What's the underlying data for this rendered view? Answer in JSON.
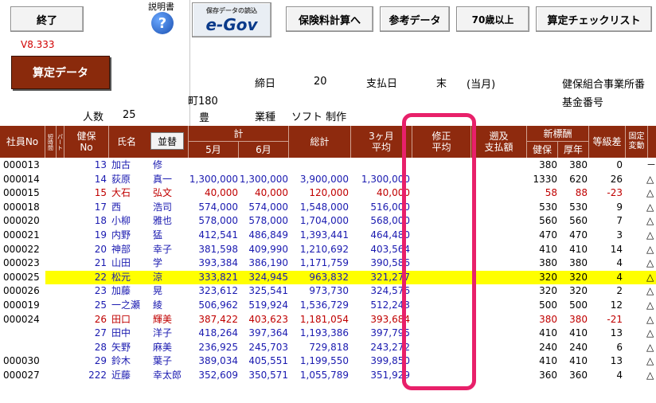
{
  "toolbar": {
    "end_label": "終了",
    "help_label": "説明書",
    "egov_sub": "保存データの読込",
    "egov_label": "e-Gov",
    "calc_label": "保険料計算へ",
    "ref_label": "参考データ",
    "over70_label": "70歳以上",
    "check_label": "算定チェックリスト"
  },
  "version": "V8.333",
  "santei_label": "算定データ",
  "info": {
    "shimebi_label": "締日",
    "shimebi_value": "20",
    "shiharai_label": "支払日",
    "shiharai_value": "末",
    "shiharai_note": "(当月)",
    "kenpo_label": "健保組合事業所番",
    "kikin_label": "基金番号",
    "address_frag": "町180",
    "addr_frag2": "豊",
    "gyoshu_label": "業種",
    "gyoshu_value": "ソフト 制作",
    "ninzu_label": "人数",
    "ninzu_value": "25"
  },
  "header": {
    "emp_no": "社員No",
    "tanjikan": "短時間",
    "part": "パート",
    "kenpo_no": "健保\nNo",
    "name": "氏名",
    "sort_btn": "並替",
    "kei": "計",
    "may": "5月",
    "jun": "6月",
    "total": "総計",
    "avg3": "3ヶ月\n平均",
    "mod_avg": "修正\n平均",
    "sokyu": "遡及\n支払額",
    "shinhyo": "新標酬",
    "kenpo": "健保",
    "kounen": "厚年",
    "grade_diff": "等級差",
    "kotei": "固定\n変動"
  },
  "rows": [
    {
      "emp": "000013",
      "no": "13",
      "ln": "加古",
      "fn": "修",
      "may": "",
      "jun": "",
      "tot": "",
      "avg": "",
      "kp": "380",
      "kn": "380",
      "diff": "0",
      "fx": "－",
      "color": "blue",
      "hl": false
    },
    {
      "emp": "000014",
      "no": "14",
      "ln": "荻原",
      "fn": "真一",
      "may": "1,300,000",
      "jun": "1,300,000",
      "tot": "3,900,000",
      "avg": "1,300,000",
      "kp": "1330",
      "kn": "620",
      "diff": "26",
      "fx": "△",
      "color": "blue",
      "hl": false
    },
    {
      "emp": "000015",
      "no": "15",
      "ln": "大石",
      "fn": "弘文",
      "may": "40,000",
      "jun": "40,000",
      "tot": "120,000",
      "avg": "40,000",
      "kp": "58",
      "kn": "88",
      "diff": "-23",
      "fx": "△",
      "color": "red",
      "hl": false
    },
    {
      "emp": "000018",
      "no": "17",
      "ln": "西",
      "fn": "浩司",
      "may": "574,000",
      "jun": "574,000",
      "tot": "1,548,000",
      "avg": "516,000",
      "kp": "530",
      "kn": "530",
      "diff": "9",
      "fx": "△",
      "color": "blue",
      "hl": false
    },
    {
      "emp": "000020",
      "no": "18",
      "ln": "小柳",
      "fn": "雅也",
      "may": "578,000",
      "jun": "578,000",
      "tot": "1,704,000",
      "avg": "568,000",
      "kp": "560",
      "kn": "560",
      "diff": "7",
      "fx": "△",
      "color": "blue",
      "hl": false
    },
    {
      "emp": "000021",
      "no": "19",
      "ln": "内野",
      "fn": "猛",
      "may": "412,541",
      "jun": "486,849",
      "tot": "1,393,441",
      "avg": "464,480",
      "kp": "470",
      "kn": "470",
      "diff": "3",
      "fx": "△",
      "color": "blue",
      "hl": false
    },
    {
      "emp": "000022",
      "no": "20",
      "ln": "神部",
      "fn": "幸子",
      "may": "381,598",
      "jun": "409,990",
      "tot": "1,210,692",
      "avg": "403,564",
      "kp": "410",
      "kn": "410",
      "diff": "14",
      "fx": "△",
      "color": "blue",
      "hl": false
    },
    {
      "emp": "000023",
      "no": "21",
      "ln": "山田",
      "fn": "学",
      "may": "393,384",
      "jun": "386,190",
      "tot": "1,171,759",
      "avg": "390,586",
      "kp": "380",
      "kn": "380",
      "diff": "4",
      "fx": "△",
      "color": "blue",
      "hl": false
    },
    {
      "emp": "000025",
      "no": "22",
      "ln": "松元",
      "fn": "涼",
      "may": "333,821",
      "jun": "324,945",
      "tot": "963,832",
      "avg": "321,277",
      "kp": "320",
      "kn": "320",
      "diff": "4",
      "fx": "△",
      "color": "blue",
      "hl": true
    },
    {
      "emp": "000026",
      "no": "23",
      "ln": "加藤",
      "fn": "晃",
      "may": "323,612",
      "jun": "325,541",
      "tot": "973,730",
      "avg": "324,576",
      "kp": "320",
      "kn": "320",
      "diff": "2",
      "fx": "△",
      "color": "blue",
      "hl": false
    },
    {
      "emp": "000019",
      "no": "25",
      "ln": "一之瀬",
      "fn": "綾",
      "may": "506,962",
      "jun": "519,924",
      "tot": "1,536,729",
      "avg": "512,243",
      "kp": "500",
      "kn": "500",
      "diff": "12",
      "fx": "△",
      "color": "blue",
      "hl": false
    },
    {
      "emp": "000024",
      "no": "26",
      "ln": "田口",
      "fn": "輝美",
      "may": "387,422",
      "jun": "403,623",
      "tot": "1,181,054",
      "avg": "393,684",
      "kp": "380",
      "kn": "380",
      "diff": "-21",
      "fx": "△",
      "color": "red",
      "hl": false
    },
    {
      "emp": "",
      "no": "27",
      "ln": "田中",
      "fn": "洋子",
      "may": "418,264",
      "jun": "397,364",
      "tot": "1,193,386",
      "avg": "397,795",
      "kp": "410",
      "kn": "410",
      "diff": "13",
      "fx": "△",
      "color": "blue",
      "hl": false
    },
    {
      "emp": "",
      "no": "28",
      "ln": "矢野",
      "fn": "麻美",
      "may": "236,925",
      "jun": "245,703",
      "tot": "729,818",
      "avg": "243,272",
      "kp": "240",
      "kn": "240",
      "diff": "6",
      "fx": "△",
      "color": "blue",
      "hl": false
    },
    {
      "emp": "000030",
      "no": "29",
      "ln": "鈴木",
      "fn": "葉子",
      "may": "389,034",
      "jun": "405,551",
      "tot": "1,199,550",
      "avg": "399,850",
      "kp": "410",
      "kn": "410",
      "diff": "13",
      "fx": "△",
      "color": "blue",
      "hl": false
    },
    {
      "emp": "000027",
      "no": "222",
      "ln": "近藤",
      "fn": "幸太郎",
      "may": "352,609",
      "jun": "350,571",
      "tot": "1,055,789",
      "avg": "351,929",
      "kp": "360",
      "kn": "360",
      "diff": "4",
      "fx": "△",
      "color": "blue",
      "hl": false
    }
  ],
  "colors": {
    "header_bg": "#8e2a0e",
    "highlight": "#ffff00",
    "blue_text": "#1a1ab0",
    "red_text": "#c00000",
    "annotation": "#e8206a"
  }
}
